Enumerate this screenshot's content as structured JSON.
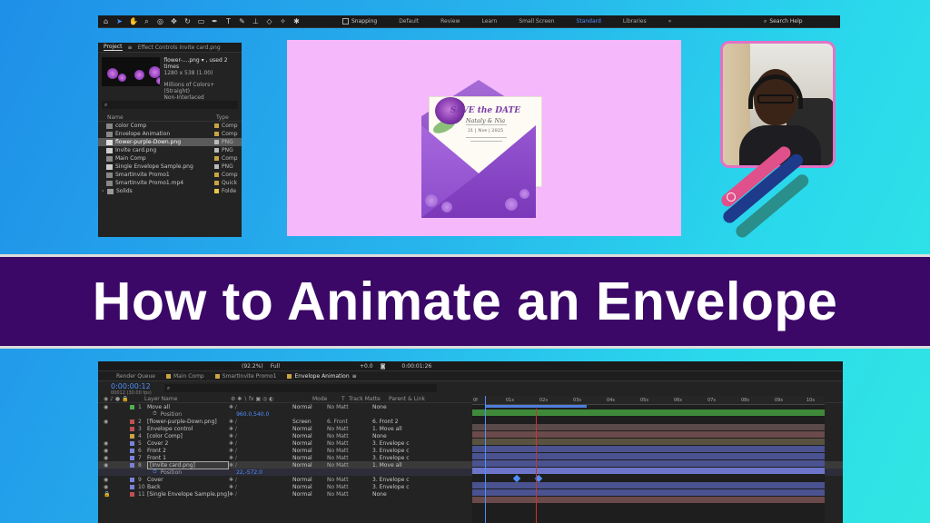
{
  "toolbar": {
    "snapping_label": "Snapping",
    "workspaces": [
      "Default",
      "Review",
      "Learn",
      "Small Screen",
      "Standard",
      "Libraries"
    ],
    "active_workspace": "Standard",
    "more": "»",
    "search_placeholder": "Search Help"
  },
  "project": {
    "tab_project": "Project",
    "tab_effects": "Effect Controls Invite card.png",
    "asset_name": "flower-....png ▾ , used 2 times",
    "asset_dims": "1280 x 538 (1.00)",
    "asset_color": "Millions of Colors+ (Straight)",
    "asset_interlace": "Non-Interlaced",
    "col_name": "Name",
    "col_type": "Type",
    "items": [
      {
        "name": "color Comp",
        "type": "Comp",
        "color": "#c8a540"
      },
      {
        "name": "Envelope Animation",
        "type": "Comp",
        "color": "#c8a540"
      },
      {
        "name": "flower-purple-Down.png",
        "type": "PNG",
        "color": "#bbbbbb"
      },
      {
        "name": "Invite card.png",
        "type": "PNG",
        "color": "#bbbbbb"
      },
      {
        "name": "Main Comp",
        "type": "Comp",
        "color": "#c8a540"
      },
      {
        "name": "Single Envelope Sample.png",
        "type": "PNG",
        "color": "#bbbbbb"
      },
      {
        "name": "SmartInvite Promo1",
        "type": "Comp",
        "color": "#c8a540"
      },
      {
        "name": "SmartInvite Promo1.mp4",
        "type": "Quick",
        "color": "#c8a540"
      },
      {
        "name": "Solids",
        "type": "Folde",
        "color": "#e6c84a"
      }
    ]
  },
  "card": {
    "headline": "SAVE the DATE",
    "names": "Nataly & Nia",
    "date": "21 | Nov | 2025"
  },
  "banner": {
    "title": "How to Animate an Envelope"
  },
  "timeline": {
    "zoom": "(92.2%)",
    "quality": "Full",
    "offset": "+0.0",
    "end_time": "0:00:01:26",
    "tabs": [
      "Render Queue",
      "Main Comp",
      "SmartInvite Promo1",
      "Envelope Animation"
    ],
    "timecode": "0:00:00:12",
    "fps": "00012 (30.00 fps)",
    "head_layer": "Layer Name",
    "head_mode": "Mode",
    "head_t": "T",
    "head_track": "Track Matte",
    "head_parent": "Parent & Link",
    "ruler": [
      "0f",
      "01s",
      "02s",
      "03s",
      "04s",
      "05s",
      "06s",
      "07s",
      "08s",
      "09s",
      "10s"
    ],
    "layers": [
      {
        "num": "1",
        "name": "Move all",
        "mode": "Normal",
        "matte": "No Matt",
        "parent": "None",
        "color": "#4caf50"
      },
      {
        "num": "2",
        "name": "[flower-purple-Down.png]",
        "mode": "Screen",
        "matte": "6. Front",
        "parent": "6. Front 2",
        "color": "#c05050"
      },
      {
        "num": "3",
        "name": "Envelope control",
        "mode": "Normal",
        "matte": "No Matt",
        "parent": "1. Move all",
        "color": "#c05050"
      },
      {
        "num": "4",
        "name": "[color Comp]",
        "mode": "Normal",
        "matte": "No Matt",
        "parent": "None",
        "color": "#c8a540"
      },
      {
        "num": "5",
        "name": "Cover 2",
        "mode": "Normal",
        "matte": "No Matt",
        "parent": "3. Envelope c",
        "color": "#7a82d8"
      },
      {
        "num": "6",
        "name": "Front 2",
        "mode": "Normal",
        "matte": "No Matt",
        "parent": "3. Envelope c",
        "color": "#7a82d8"
      },
      {
        "num": "7",
        "name": "Front 1",
        "mode": "Normal",
        "matte": "No Matt",
        "parent": "3. Envelope c",
        "color": "#7a82d8"
      },
      {
        "num": "8",
        "name": "[Invite card.png]",
        "mode": "Normal",
        "matte": "No Matt",
        "parent": "1. Move all",
        "color": "#7a82d8"
      },
      {
        "num": "9",
        "name": "Cover",
        "mode": "Normal",
        "matte": "No Matt",
        "parent": "3. Envelope c",
        "color": "#7a82d8"
      },
      {
        "num": "10",
        "name": "Back",
        "mode": "Normal",
        "matte": "No Matt",
        "parent": "3. Envelope c",
        "color": "#7a82d8"
      },
      {
        "num": "11",
        "name": "[Single Envelope Sample.png]",
        "mode": "Normal",
        "matte": "No Matt",
        "parent": "None",
        "color": "#c05050"
      }
    ],
    "prop1_name": "Position",
    "prop1_value": "960.0,540.0",
    "prop2_name": "Position",
    "prop2_value": "22,-572.0"
  },
  "colors": {
    "accent": "#4e8fff",
    "banner_bg": "#3c0868",
    "viewer_bg": "#f4b8fb",
    "envelope": "#8a4dc4"
  }
}
